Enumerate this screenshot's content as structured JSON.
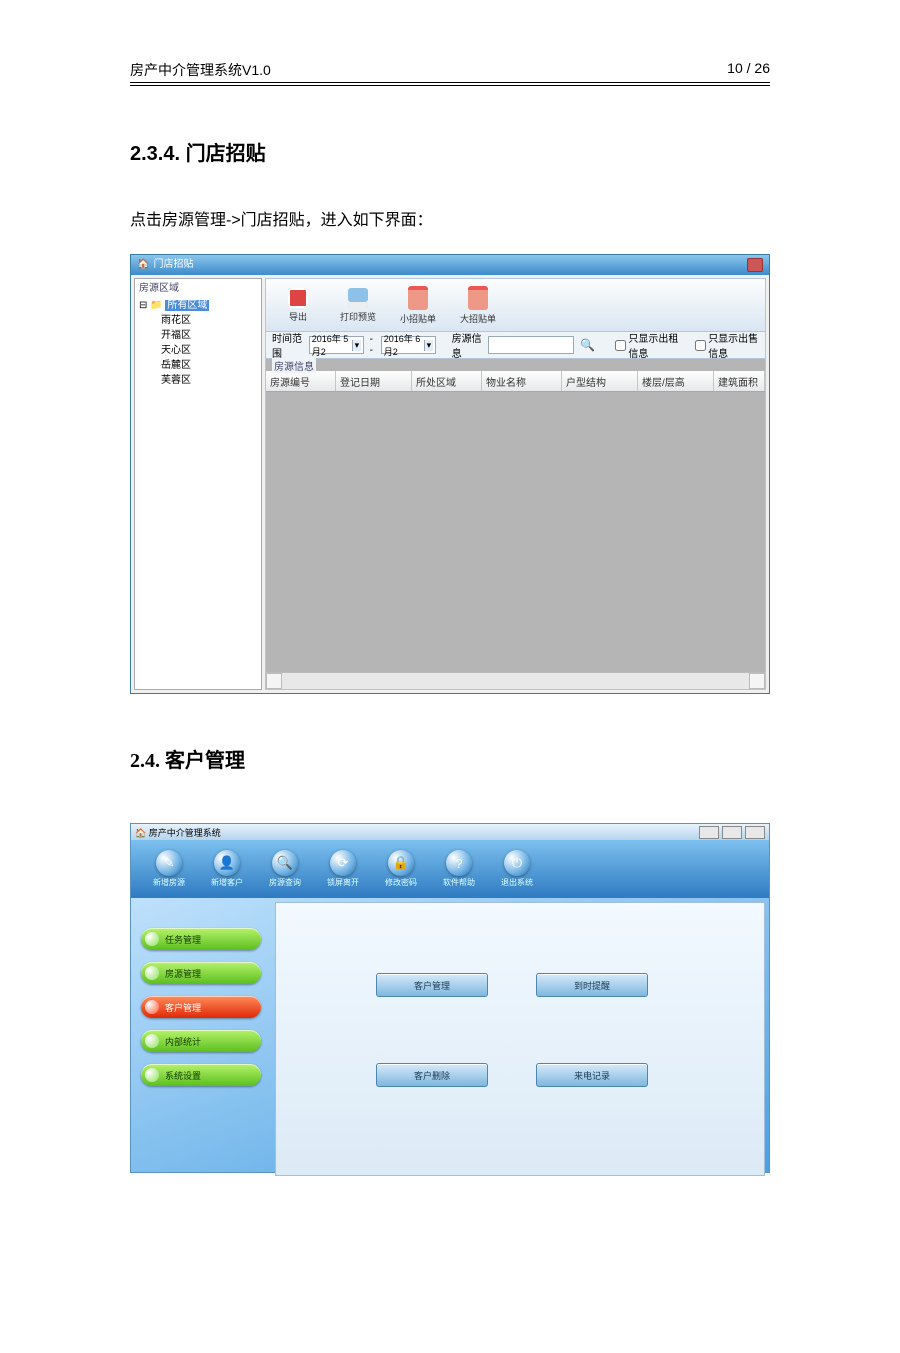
{
  "doc": {
    "header_left": "房产中介管理系统V1.0",
    "header_right": "10 / 26",
    "section_234": "2.3.4. 门店招贴",
    "para1": "点击房源管理->门店招贴，进入如下界面：",
    "section_24": "2.4. 客户管理"
  },
  "win1": {
    "title": "门店招贴",
    "tree_legend": "房源区域",
    "tree_root": "所有区域",
    "tree_items": [
      "雨花区",
      "开福区",
      "天心区",
      "岳麓区",
      "芙蓉区"
    ],
    "toolbar": {
      "export": "导出",
      "print": "打印预览",
      "small": "小招贴单",
      "big": "大招贴单"
    },
    "filter": {
      "range_label": "时间范围",
      "date_from": "2016年 5月2",
      "date_to": "2016年 6月2",
      "sep": "--",
      "info_label": "房源信息",
      "chk_rent": "只显示出租信息",
      "chk_sale": "只显示出售信息"
    },
    "grid_legend": "房源信息",
    "columns": [
      "房源编号",
      "登记日期",
      "所处区域",
      "物业名称",
      "户型结构",
      "楼层/层高",
      "建筑面积"
    ]
  },
  "win2": {
    "title": "房产中介管理系统",
    "top": [
      {
        "lbl": "新增房源",
        "glyph": "✎"
      },
      {
        "lbl": "新增客户",
        "glyph": "👤"
      },
      {
        "lbl": "房源查询",
        "glyph": "🔍"
      },
      {
        "lbl": "锁屏离开",
        "glyph": "⟳"
      },
      {
        "lbl": "修改密码",
        "glyph": "🔒"
      },
      {
        "lbl": "软件帮助",
        "glyph": "?"
      },
      {
        "lbl": "退出系统",
        "glyph": "⏻"
      }
    ],
    "nav": [
      {
        "lbl": "任务管理",
        "active": false
      },
      {
        "lbl": "房源管理",
        "active": false
      },
      {
        "lbl": "客户管理",
        "active": true
      },
      {
        "lbl": "内部统计",
        "active": false
      },
      {
        "lbl": "系统设置",
        "active": false
      }
    ],
    "buttons": {
      "b1": "客户管理",
      "b2": "到时提醒",
      "b3": "客户删除",
      "b4": "来电记录"
    }
  }
}
